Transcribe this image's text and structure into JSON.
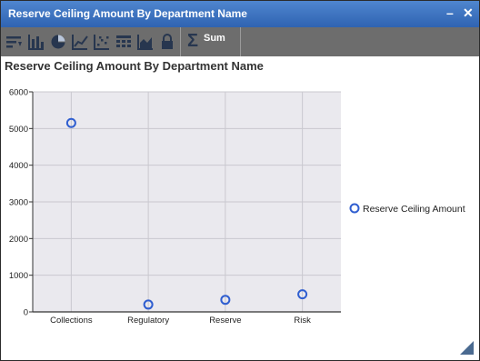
{
  "window": {
    "title": "Reserve Ceiling Amount By Department Name",
    "minimize_label": "–",
    "close_label": "✕"
  },
  "toolbar": {
    "icons": [
      "sort-icon",
      "bar-chart-icon",
      "pie-chart-icon",
      "line-chart-icon",
      "scatter-icon",
      "grid-icon",
      "area-chart-icon",
      "lock-icon"
    ],
    "sum_symbol": "Σ",
    "sum_label": "Sum"
  },
  "colors": {
    "title_bar": "#2f63b2",
    "toolbar": "#6d6d6d",
    "plot_bg": "#eae9ee",
    "marker": "#2f5ed0"
  },
  "chart_data": {
    "type": "scatter",
    "title": "Reserve Ceiling Amount By Department Name",
    "categories": [
      "Collections",
      "Regulatory",
      "Reserve",
      "Risk"
    ],
    "series": [
      {
        "name": "Reserve Ceiling Amount",
        "values": [
          5150,
          200,
          330,
          480
        ]
      }
    ],
    "ylim": [
      0,
      6000
    ],
    "yticks": [
      0,
      1000,
      2000,
      3000,
      4000,
      5000,
      6000
    ],
    "grid": true,
    "legend": "right"
  }
}
